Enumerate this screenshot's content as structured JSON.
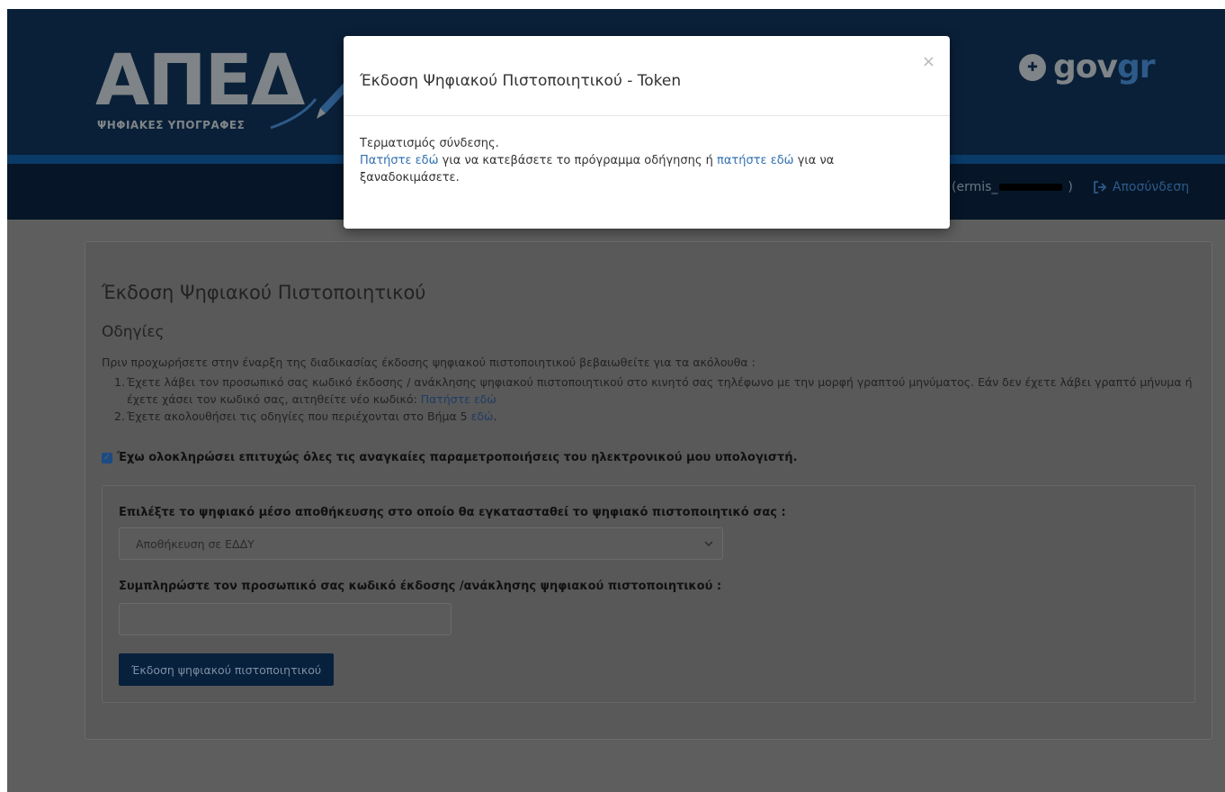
{
  "header": {
    "logo_text": "ΑΠΕΔ",
    "logo_subtitle": "ΨΗΦΙΑΚΕΣ ΥΠΟΓΡΑΦΕΣ",
    "gov_brand_prefix": "gov",
    "gov_brand_suffix": "gr",
    "username": "(ermis_",
    "username_end": ")",
    "logout_label": "Αποσύνδεση",
    "logout_icon": "sign-out-icon"
  },
  "main": {
    "title": "Έκδοση Ψηφιακού Πιστοποιητικού",
    "instructions_title": "Οδηγίες",
    "instructions_intro": "Πριν προχωρήσετε στην έναρξη της διαδικασίας έκδοσης ψηφιακού πιστοποιητικού βεβαιωθείτε για τα ακόλουθα :",
    "steps": [
      {
        "num": "1.",
        "text": "Έχετε λάβει τον προσωπικό σας κωδικό έκδοσης / ανάκλησης ψηφιακού πιστοποιητικού στο κινητό σας τηλέφωνο με την μορφή γραπτού μηνύματος. Εάν δεν έχετε λάβει γραπτό μήνυμα ή έχετε χάσει τον κωδικό σας, αιτηθείτε νέο κωδικό: ",
        "link": "Πατήστε εδώ"
      },
      {
        "num": "2.",
        "text": "Έχετε ακολουθήσει τις οδηγίες που περιέχονται στο Βήμα 5 ",
        "link": "εδώ",
        "tail": "."
      }
    ],
    "confirm_label": "Έχω ολοκληρώσει επιτυχώς όλες τις αναγκαίες παραμετροποιήσεις του ηλεκτρονικού μου υπολογιστή.",
    "confirm_checked": true,
    "form": {
      "media_label": "Επιλέξτε το ψηφιακό μέσο αποθήκευσης στο οποίο θα εγκατασταθεί το ψηφιακό πιστοποιητικό σας :",
      "media_selected": "Αποθήκευση σε ΕΔΔΥ",
      "code_label": "Συμπληρώστε τον προσωπικό σας κωδικό έκδοσης /ανάκλησης ψηφιακού πιστοποιητικού :",
      "code_value": "",
      "issue_button": "Έκδοση ψηφιακού πιστοποιητικού"
    }
  },
  "modal": {
    "title": "Έκδοση Ψηφιακού Πιστοποιητικού - Token",
    "close_label": "×",
    "line1": "Τερματισμός σύνδεσης.",
    "link1": "Πατήστε εδώ",
    "text_mid": " για να κατεβάσετε το πρόγραμμα οδήγησης ή ",
    "link2": "πατήστε εδώ",
    "text_end": " για να ξαναδοκιμάσετε."
  },
  "colors": {
    "header_bg": "#0a2038",
    "overlay_bg": "#5e5e5e",
    "link": "#2f6fb0",
    "button_bg": "#07203c"
  }
}
